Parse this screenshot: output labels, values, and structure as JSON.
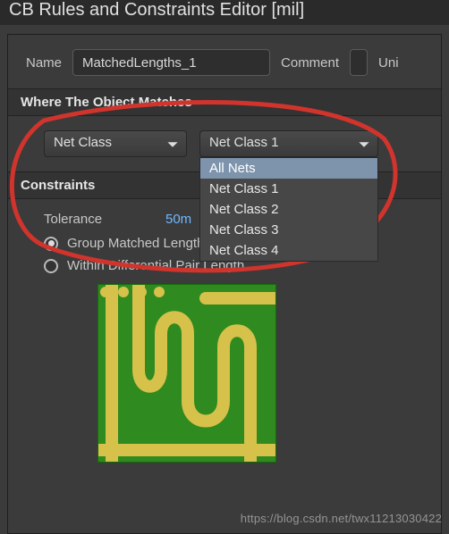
{
  "window": {
    "title": "CB Rules and Constraints Editor [mil]"
  },
  "fields": {
    "name_label": "Name",
    "name_value": "MatchedLengths_1",
    "comment_label": "Comment",
    "uni_label": "Uni"
  },
  "sections": {
    "matches": "Where The Object Matches",
    "constraints": "Constraints"
  },
  "selects": {
    "scope": {
      "value": "Net Class"
    },
    "target": {
      "value": "Net Class 1",
      "options": [
        "All Nets",
        "Net Class 1",
        "Net Class 2",
        "Net Class 3",
        "Net Class 4"
      ],
      "highlighted": "All Nets"
    }
  },
  "constraints": {
    "tolerance_label": "Tolerance",
    "tolerance_value": "50m",
    "radio1": "Group Matched Lengths",
    "radio2": "Within Differential Pair Length"
  },
  "watermark": "https://blog.csdn.net/twx11213030422"
}
